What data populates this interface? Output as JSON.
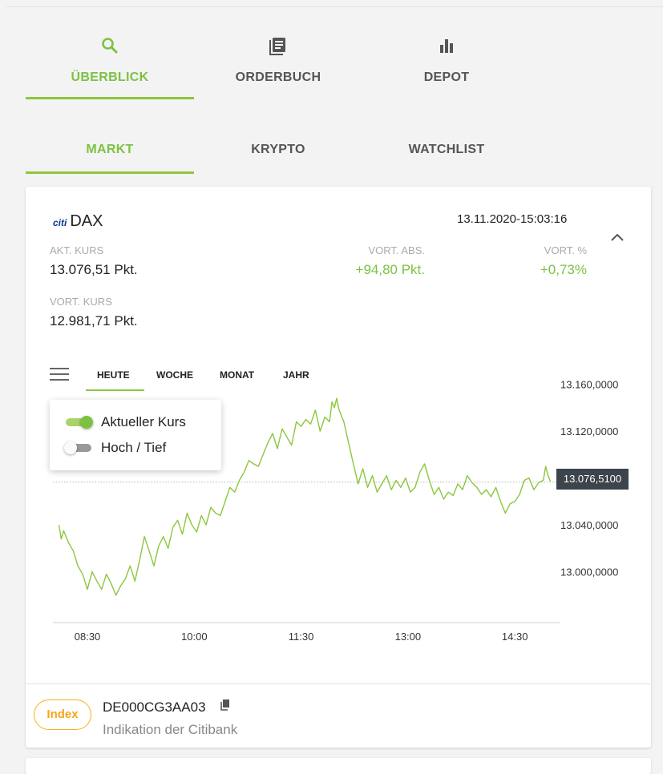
{
  "main_tabs": [
    {
      "label": "ÜBERBLICK",
      "icon": "search-icon",
      "active": true
    },
    {
      "label": "ORDERBUCH",
      "icon": "document-list-icon",
      "active": false
    },
    {
      "label": "DEPOT",
      "icon": "bar-chart-icon",
      "active": false
    }
  ],
  "sub_tabs": [
    {
      "label": "MARKT",
      "active": true
    },
    {
      "label": "KRYPTO",
      "active": false
    },
    {
      "label": "WATCHLIST",
      "active": false
    }
  ],
  "card": {
    "logo_text": "citi",
    "title": "DAX",
    "timestamp": "13.11.2020-15:03:16",
    "akt_kurs_label": "AKT. KURS",
    "akt_kurs_value": "13.076,51 Pkt.",
    "vort_abs_label": "VORT. ABS.",
    "vort_abs_value": "+94,80 Pkt.",
    "vort_pct_label": "VORT. %",
    "vort_pct_value": "+0,73%",
    "vort_kurs_label": "VORT. KURS",
    "vort_kurs_value": "12.981,71 Pkt."
  },
  "chart": {
    "range_tabs": [
      "HEUTE",
      "WOCHE",
      "MONAT",
      "JAHR"
    ],
    "active_range": "HEUTE",
    "legend": [
      {
        "label": "Aktueller Kurs",
        "enabled": true
      },
      {
        "label": "Hoch / Tief",
        "enabled": false
      }
    ],
    "current_price_tag": "13.076,5100",
    "colors": {
      "line": "#8cc63f",
      "accent": "#7cc242",
      "tag_bg": "#3c444c"
    }
  },
  "chart_data": {
    "type": "line",
    "y_ticks": [
      13000,
      13040,
      13120,
      13160
    ],
    "y_tick_labels": [
      "13.000,0000",
      "13.040,0000",
      "13.120,0000",
      "13.160,0000"
    ],
    "x_ticks": [
      "08:30",
      "10:00",
      "11:30",
      "13:00",
      "14:30"
    ],
    "x_tick_values": [
      510,
      600,
      690,
      780,
      870
    ],
    "xlim": [
      485,
      905
    ],
    "ylim": [
      12956,
      13185
    ],
    "current_value": 13076.51,
    "series": [
      {
        "x": [
          486,
          488,
          490,
          494,
          498,
          502,
          506,
          510,
          514,
          518,
          522,
          526,
          530,
          534,
          538,
          542,
          546,
          550,
          554,
          558,
          562,
          566,
          570,
          574,
          578,
          582,
          586,
          590,
          594,
          598,
          602,
          606,
          610,
          614,
          618,
          622,
          626,
          630,
          634,
          638,
          642,
          646,
          650,
          654,
          658,
          662,
          666,
          670,
          674,
          678,
          682,
          686,
          690,
          694,
          698,
          702,
          706,
          710,
          714,
          716,
          718,
          720,
          722,
          726,
          730,
          734,
          738,
          742,
          746,
          750,
          754,
          758,
          762,
          766,
          770,
          774,
          778,
          782,
          786,
          790,
          794,
          798,
          802,
          806,
          810,
          814,
          818,
          822,
          826,
          830,
          834,
          838,
          842,
          846,
          850,
          854,
          858,
          862,
          866,
          870,
          874,
          878,
          882,
          886,
          890,
          894,
          896,
          898,
          900
        ],
        "y": [
          13040,
          13028,
          13035,
          13025,
          13018,
          13005,
          12998,
          12985,
          13000,
          12992,
          12985,
          12998,
          12990,
          12980,
          12988,
          12994,
          13005,
          12992,
          13010,
          13030,
          13018,
          13005,
          13022,
          13030,
          13020,
          13038,
          13044,
          13032,
          13050,
          13040,
          13034,
          13048,
          13040,
          13055,
          13050,
          13048,
          13060,
          13072,
          13068,
          13078,
          13085,
          13095,
          13092,
          13090,
          13100,
          13110,
          13118,
          13105,
          13122,
          13115,
          13108,
          13128,
          13124,
          13130,
          13126,
          13138,
          13120,
          13132,
          13128,
          13145,
          13140,
          13148,
          13138,
          13128,
          13110,
          13092,
          13075,
          13088,
          13072,
          13082,
          13068,
          13075,
          13082,
          13070,
          13078,
          13072,
          13080,
          13068,
          13072,
          13085,
          13092,
          13078,
          13066,
          13072,
          13062,
          13068,
          13065,
          13075,
          13070,
          13082,
          13076,
          13072,
          13066,
          13070,
          13064,
          13072,
          13060,
          13050,
          13058,
          13060,
          13066,
          13078,
          13080,
          13070,
          13076,
          13078,
          13090,
          13082,
          13077
        ]
      }
    ]
  },
  "footer": {
    "badge": "Index",
    "isin": "DE000CG3AA03",
    "source": "Indikation der Citibank"
  }
}
